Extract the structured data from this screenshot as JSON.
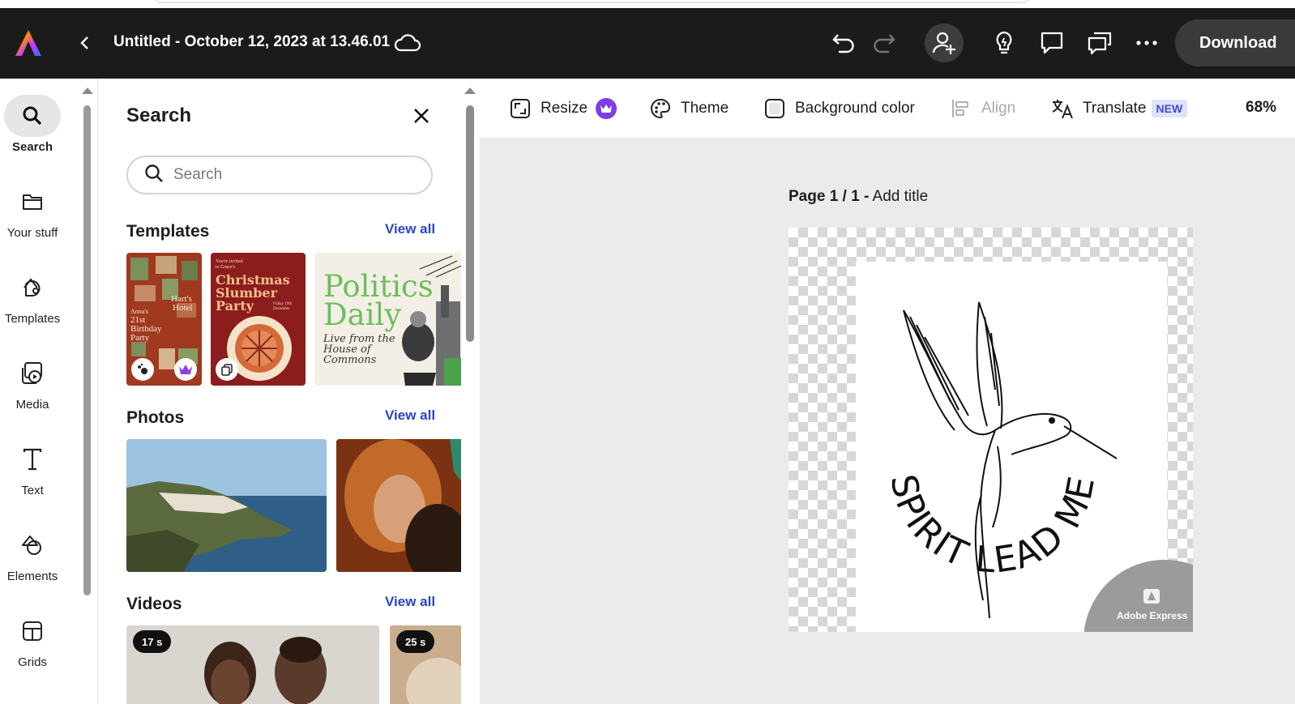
{
  "header": {
    "doc_title": "Untitled - October 12, 2023 at 13.46.01",
    "download_label": "Download"
  },
  "rail": {
    "items": [
      {
        "label": "Search",
        "icon": "search-icon",
        "active": true
      },
      {
        "label": "Your stuff",
        "icon": "folder-icon"
      },
      {
        "label": "Templates",
        "icon": "templates-icon"
      },
      {
        "label": "Media",
        "icon": "media-icon"
      },
      {
        "label": "Text",
        "icon": "text-icon"
      },
      {
        "label": "Elements",
        "icon": "elements-icon"
      },
      {
        "label": "Grids",
        "icon": "grids-icon"
      }
    ]
  },
  "panel": {
    "title": "Search",
    "search_placeholder": "Search",
    "templates": {
      "title": "Templates",
      "view_all": "View all",
      "items": [
        {
          "lines": [
            "Anna's",
            "21st",
            "Birthday",
            "Party"
          ],
          "side": [
            "Hart's",
            "Hotel"
          ]
        },
        {
          "small": "You're invited to Grace's",
          "title": "Christmas Slumber Party",
          "date": "Friday 19th December"
        },
        {
          "title1": "Politics",
          "title2": "Daily",
          "sub": "Live from the House of Commons"
        }
      ]
    },
    "photos": {
      "title": "Photos",
      "view_all": "View all"
    },
    "videos": {
      "title": "Videos",
      "view_all": "View all",
      "items": [
        {
          "duration": "17 s"
        },
        {
          "duration": "25 s"
        }
      ]
    }
  },
  "toolbar": {
    "resize": "Resize",
    "theme": "Theme",
    "background_color": "Background color",
    "align": "Align",
    "translate": "Translate",
    "new_badge": "NEW",
    "zoom": "68%"
  },
  "canvas": {
    "page_prefix": "Page 1 / 1 -",
    "page_title": "Add title",
    "artwork_text": "SPIRIT LEAD ME",
    "watermark": "Adobe Express"
  },
  "colors": {
    "topbar": "#1b1b1b",
    "link": "#2b44c9",
    "premium": "#7b3fe4"
  }
}
